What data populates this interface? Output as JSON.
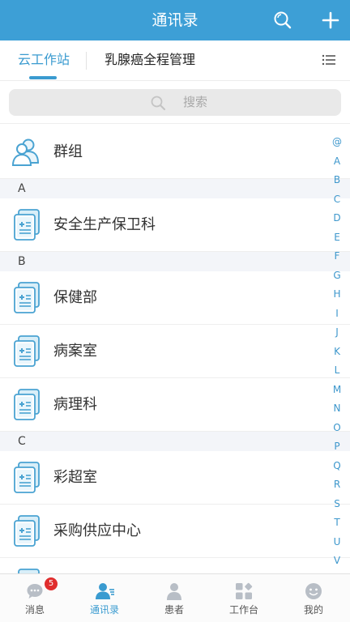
{
  "header": {
    "title": "通讯录",
    "search_icon": "search-icon",
    "add_icon": "plus-icon"
  },
  "tabs": [
    {
      "label": "云工作站",
      "active": true
    },
    {
      "label": "乳腺癌全程管理",
      "active": false
    }
  ],
  "tabs_menu_icon": "list-icon",
  "search": {
    "placeholder": "搜索",
    "icon": "search-icon"
  },
  "groups": {
    "label": "群组",
    "icon": "people-icon"
  },
  "sections": [
    {
      "letter": "A",
      "items": [
        "安全生产保卫科"
      ]
    },
    {
      "letter": "B",
      "items": [
        "保健部",
        "病案室",
        "病理科"
      ]
    },
    {
      "letter": "C",
      "items": [
        "彩超室",
        "采购供应中心"
      ]
    }
  ],
  "department_icon": "medical-files-icon",
  "index_bar": [
    "@",
    "A",
    "B",
    "C",
    "D",
    "E",
    "F",
    "G",
    "H",
    "I",
    "J",
    "K",
    "L",
    "M",
    "N",
    "O",
    "P",
    "Q",
    "R",
    "S",
    "T",
    "U",
    "V"
  ],
  "bottom_nav": [
    {
      "label": "消息",
      "icon": "chat-icon",
      "badge": "5",
      "active": false
    },
    {
      "label": "通讯录",
      "icon": "contacts-icon",
      "active": true
    },
    {
      "label": "患者",
      "icon": "patient-icon",
      "active": false
    },
    {
      "label": "工作台",
      "icon": "workbench-icon",
      "active": false
    },
    {
      "label": "我的",
      "icon": "profile-icon",
      "active": false
    }
  ],
  "colors": {
    "primary": "#3d9fd6",
    "badge": "#e02d2d",
    "section_bg": "#f3f5f9"
  }
}
